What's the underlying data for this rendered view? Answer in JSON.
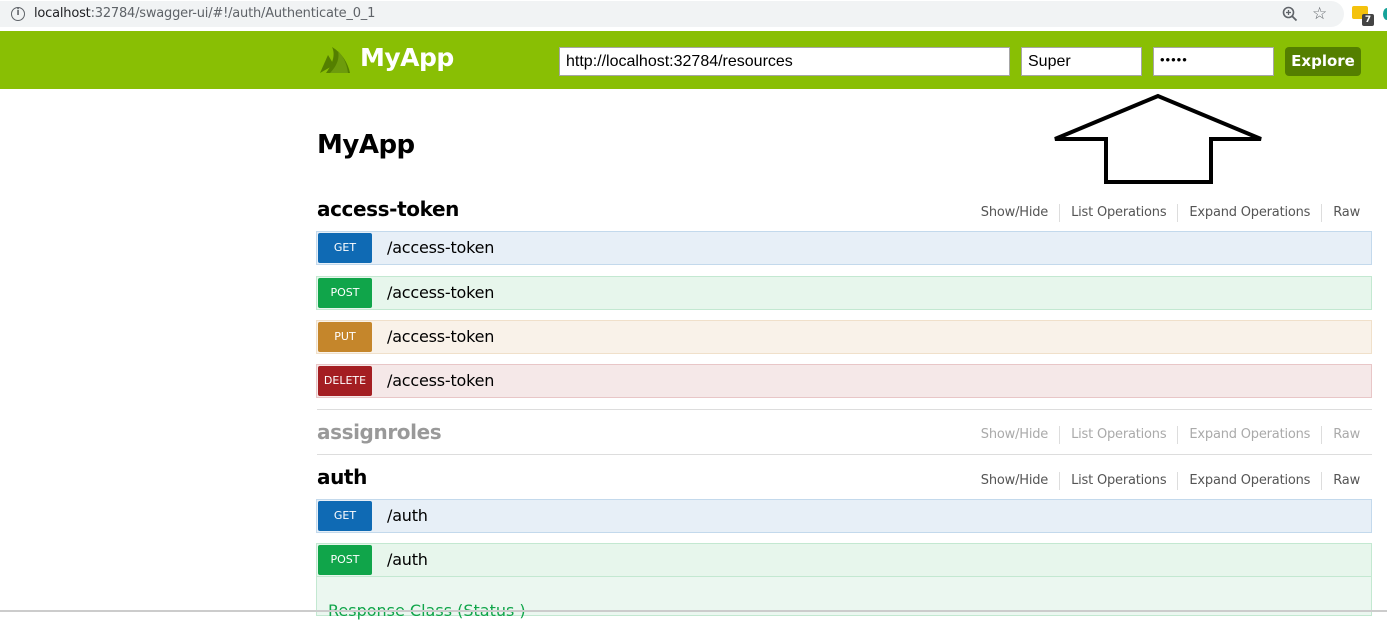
{
  "browser": {
    "url_host": "localhost",
    "url_rest": ":32784/swagger-ui/#!/auth/Authenticate_0_1",
    "extension_badge": "7",
    "icons": [
      "info-icon",
      "zoom-icon",
      "star-icon",
      "extension-icon"
    ]
  },
  "header": {
    "logo_text": "MyApp",
    "base_url_value": "http://localhost:32784/resources",
    "api_key_value": "Super",
    "password_value": "•••••",
    "explore_label": "Explore",
    "brand_color": "#89bf04",
    "explore_color": "#547f00"
  },
  "annotation": {
    "type": "arrow-up-outline",
    "points_to": "password-field"
  },
  "main": {
    "title": "MyApp",
    "resource_options": [
      "Show/Hide",
      "List Operations",
      "Expand Operations",
      "Raw"
    ],
    "resources": [
      {
        "name": "access-token",
        "expanded": true,
        "operations": [
          {
            "method": "GET",
            "path": "/access-token"
          },
          {
            "method": "POST",
            "path": "/access-token"
          },
          {
            "method": "PUT",
            "path": "/access-token"
          },
          {
            "method": "DELETE",
            "path": "/access-token"
          }
        ]
      },
      {
        "name": "assignroles",
        "expanded": false,
        "operations": []
      },
      {
        "name": "auth",
        "expanded": true,
        "operations": [
          {
            "method": "GET",
            "path": "/auth"
          },
          {
            "method": "POST",
            "path": "/auth",
            "expanded": true,
            "content_heading": "Response Class (Status )"
          }
        ]
      }
    ]
  },
  "method_colors": {
    "GET": "#0f6ab4",
    "POST": "#10a54a",
    "PUT": "#c5862b",
    "DELETE": "#a41e22"
  }
}
